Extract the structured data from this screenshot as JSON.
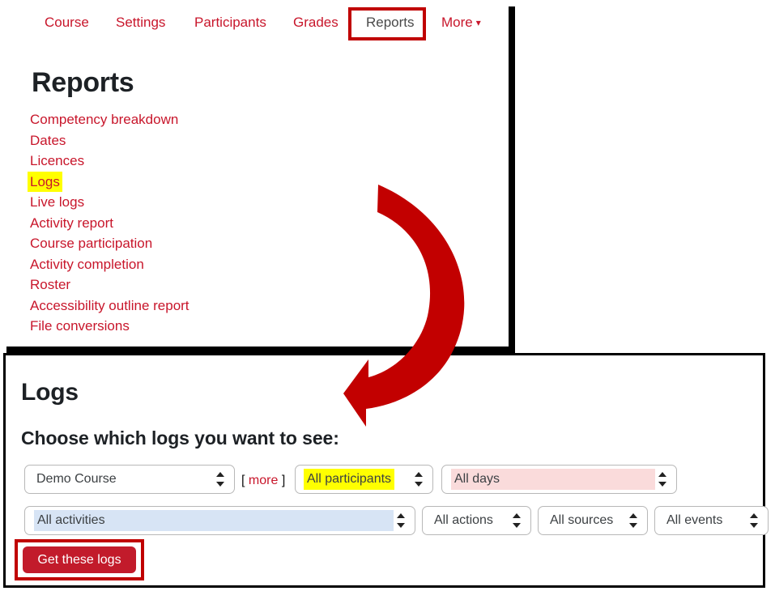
{
  "top_panel": {
    "tabs": [
      {
        "id": "course",
        "label": "Course",
        "active": false
      },
      {
        "id": "settings",
        "label": "Settings",
        "active": false
      },
      {
        "id": "participants",
        "label": "Participants",
        "active": false
      },
      {
        "id": "grades",
        "label": "Grades",
        "active": false
      },
      {
        "id": "reports",
        "label": "Reports",
        "active": true
      },
      {
        "id": "more",
        "label": "More",
        "active": false
      }
    ],
    "more_chevron_icon": "chevron-down-icon",
    "heading": "Reports",
    "links": [
      {
        "label": "Competency breakdown",
        "highlighted": false
      },
      {
        "label": "Dates",
        "highlighted": false
      },
      {
        "label": "Licences",
        "highlighted": false
      },
      {
        "label": "Logs",
        "highlighted": true
      },
      {
        "label": "Live logs",
        "highlighted": false
      },
      {
        "label": "Activity report",
        "highlighted": false
      },
      {
        "label": "Course participation",
        "highlighted": false
      },
      {
        "label": "Activity completion",
        "highlighted": false
      },
      {
        "label": "Roster",
        "highlighted": false
      },
      {
        "label": "Accessibility outline report",
        "highlighted": false
      },
      {
        "label": "File conversions",
        "highlighted": false
      }
    ]
  },
  "annotations": {
    "reports_tab_box_color": "#c00000",
    "get_logs_box_color": "#c00000",
    "arrow_icon": "curved-arrow-icon",
    "arrow_color": "#c20000",
    "logs_link_highlight_color": "#ffff00"
  },
  "bottom_panel": {
    "heading": "Logs",
    "subheading": "Choose which logs you want to see:",
    "more_link": {
      "open_bracket": "[",
      "label": "more",
      "close_bracket": "]"
    },
    "selects": [
      {
        "id": "course",
        "value": "Demo Course",
        "highlight": "none"
      },
      {
        "id": "participants",
        "value": "All participants",
        "highlight": "#ffff00"
      },
      {
        "id": "days",
        "value": "All days",
        "highlight": "#fadbdb"
      },
      {
        "id": "activities",
        "value": "All activities",
        "highlight": "#d7e4f5"
      },
      {
        "id": "actions",
        "value": "All actions",
        "highlight": "none"
      },
      {
        "id": "sources",
        "value": "All sources",
        "highlight": "none"
      },
      {
        "id": "events",
        "value": "All events",
        "highlight": "none"
      }
    ],
    "submit_button": {
      "label": "Get these logs",
      "color": "#c21b2b"
    }
  }
}
